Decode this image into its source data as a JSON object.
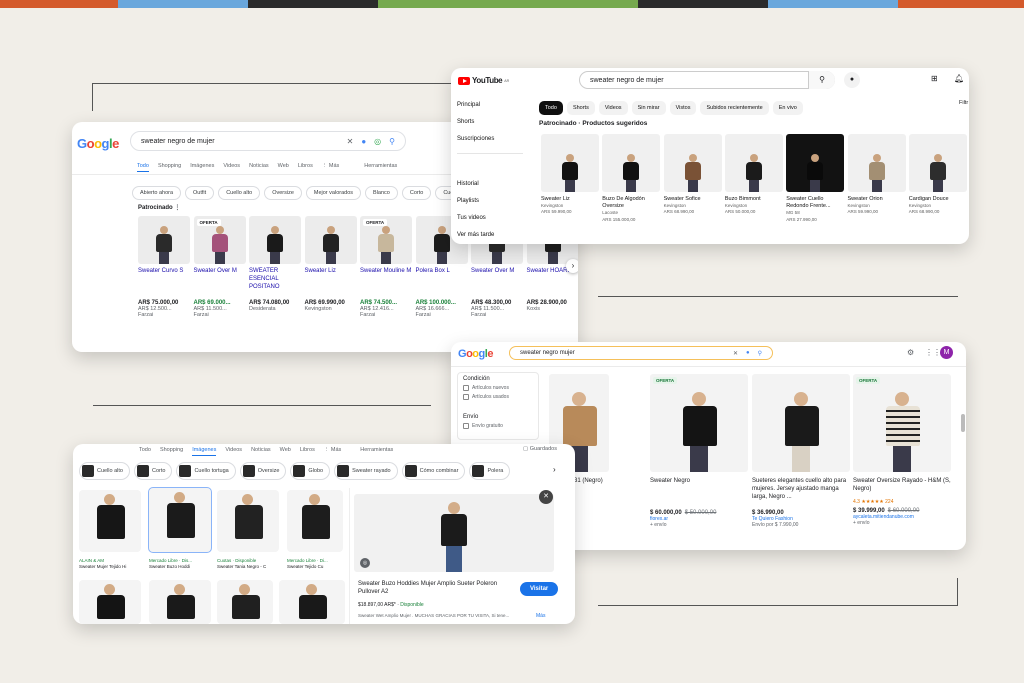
{
  "colors": {
    "stripes": [
      "#d45a2b",
      "#6aa7dc",
      "#2b2b2b",
      "#76a94e",
      "#2b2b2b",
      "#6aa7dc",
      "#d45a2b"
    ]
  },
  "google1": {
    "logo": "Google",
    "query": "sweater negro de mujer",
    "tabs": [
      "Todo",
      "Shopping",
      "Imágenes",
      "Videos",
      "Noticias",
      "Web",
      "Libros",
      "⋮ Más",
      "Herramientas"
    ],
    "chips": [
      "Abierto ahora",
      "Outfit",
      "Cuello alto",
      "Oversize",
      "Mejor valorados",
      "Blanco",
      "Corto",
      "Cuello v",
      "S"
    ],
    "sponsored": "Patrocinado",
    "products": [
      {
        "name": "Sweater Curvo S",
        "badge": "",
        "price": "AR$ 75.000,00",
        "old": "AR$ 12.500...",
        "store": "Farzai",
        "green": false
      },
      {
        "name": "Sweater Over M",
        "badge": "OFERTA",
        "price": "AR$ 69.000...",
        "old": "AR$ 11.500...",
        "store": "Farzai",
        "green": true
      },
      {
        "name": "SWEATER ESENCIAL POSITANO",
        "badge": "",
        "price": "AR$ 74.080,00",
        "old": "",
        "store": "Desiderata",
        "green": false
      },
      {
        "name": "Sweater Liz",
        "badge": "",
        "price": "AR$ 69.990,00",
        "old": "",
        "store": "Kevingston",
        "green": false
      },
      {
        "name": "Sweater Mouline M",
        "badge": "OFERTA",
        "price": "AR$ 74.500...",
        "old": "AR$ 12.416...",
        "store": "Farzai",
        "green": true
      },
      {
        "name": "Polera Box L",
        "badge": "",
        "price": "AR$ 100.000...",
        "old": "AR$ 16.666...",
        "store": "Farzai",
        "green": true
      },
      {
        "name": "Sweater Over M",
        "badge": "OFERTA",
        "price": "AR$ 48.300,00",
        "old": "AR$ 11.500...",
        "store": "Farzai",
        "green": false
      },
      {
        "name": "Sweater HOARD",
        "badge": "",
        "price": "AR$ 28.900,00",
        "old": "",
        "store": "Koxis",
        "green": false
      }
    ]
  },
  "youtube": {
    "logo": "YouTube",
    "logo_sup": "AR",
    "query": "sweater negro de mujer",
    "sidebar": [
      "Principal",
      "Shorts",
      "Suscripciones",
      "Historial",
      "Playlists",
      "Tus videos",
      "Ver más tarde"
    ],
    "chips": [
      "Todo",
      "Shorts",
      "Videos",
      "Sin mirar",
      "Vistos",
      "Subidos recientemente",
      "En vivo"
    ],
    "filters": "Filtr",
    "section": "Patrocinado · Productos sugeridos",
    "products": [
      {
        "name": "Sweater Liz",
        "store": "Kevingston",
        "price": "ARS 59.990,00",
        "old": ""
      },
      {
        "name": "Buzo De Algodón Oversize",
        "store": "Lacoste",
        "price": "ARS 155.000,00",
        "old": ""
      },
      {
        "name": "Sweater Sofice",
        "store": "Kevingston",
        "price": "ARS 68.990,00",
        "old": ""
      },
      {
        "name": "Buzo Bimmont",
        "store": "Kevingston",
        "price": "ARS 50.000,00",
        "old": ""
      },
      {
        "name": "Sweater Cuello Redondo Frente...",
        "store": "MG 58",
        "price": "ARS 27.990,00",
        "old": ""
      },
      {
        "name": "Sweater Orion",
        "store": "Kevingston",
        "price": "ARS 59.990,00",
        "old": ""
      },
      {
        "name": "Cardigan Douce",
        "store": "Kevingston",
        "price": "ARS 68.990,00",
        "old": ""
      }
    ]
  },
  "google2": {
    "logo": "Google",
    "query": "sweater negro mujer",
    "avatar": "M",
    "filter_title": "Condición",
    "filter_opts": [
      "Artículos nuevos",
      "Artículos usados"
    ],
    "ship_title": "Envío",
    "ship_opts": [
      "Envío gratuito"
    ],
    "products": [
      {
        "badge": "",
        "name": "Liso Art 031 (Negro)",
        "price": "5.00",
        "old": "",
        "store": "",
        "ship": ""
      },
      {
        "badge": "OFERTA",
        "name": "Sweater Negro",
        "price": "$ 60.000,00",
        "old": "$ 50.000,00",
        "store": "fiorex.ar",
        "ship": "+ envío"
      },
      {
        "badge": "",
        "name": "Sueteres elegantes cuello alto para mujeres. Jersey ajustado manga larga, Negro ...",
        "price": "$ 36.990,00",
        "old": "",
        "store": "Te Quiero Fashion",
        "ship": "Envío por $ 7.990,00"
      },
      {
        "badge": "OFERTA",
        "name": "Sweater Oversize Rayado - H&M (S, Negro)",
        "price": "$ 39.999,00",
        "old": "$ 60.000,00",
        "store": "aycaleta.mitiendanube.com",
        "ship": "+ envío",
        "rating": "4.3 ★★★★★ 224"
      }
    ]
  },
  "images": {
    "tabs": [
      "Todo",
      "Shopping",
      "Imágenes",
      "Videos",
      "Noticias",
      "Web",
      "Libros",
      "⋮ Más",
      "Herramientas"
    ],
    "saved": "Guardados",
    "chips": [
      "Cuello alto",
      "Corto",
      "Cuello tortuga",
      "Oversize",
      "Globo",
      "Sweater rayado",
      "Cómo combinar",
      "Polera"
    ],
    "captions": [
      {
        "src": "ALAIN & AM",
        "title": "Sweater Mujer Tejido Hi"
      },
      {
        "src": "Mercado Libre · Dis...",
        "title": "Sweater Buzo Hoddi"
      },
      {
        "src": "Cuotas · Disponible",
        "title": "Sweater Tania Negro - C"
      },
      {
        "src": "Mercado Libre · Di...",
        "title": "Sweater Tejido Cu"
      }
    ],
    "preview": {
      "title": "Sweater Buzo Hoddies Mujer Amplio Sueter Poleron Pullover A2",
      "price": "$18.897,00 AR$*",
      "stock": "Disponible",
      "desc": "Sweater Wet Amplio Mujer . MUCHAS GRACIAS POR TU VISITA, Si tene...",
      "more": "Más",
      "visit": "Visitar"
    }
  }
}
